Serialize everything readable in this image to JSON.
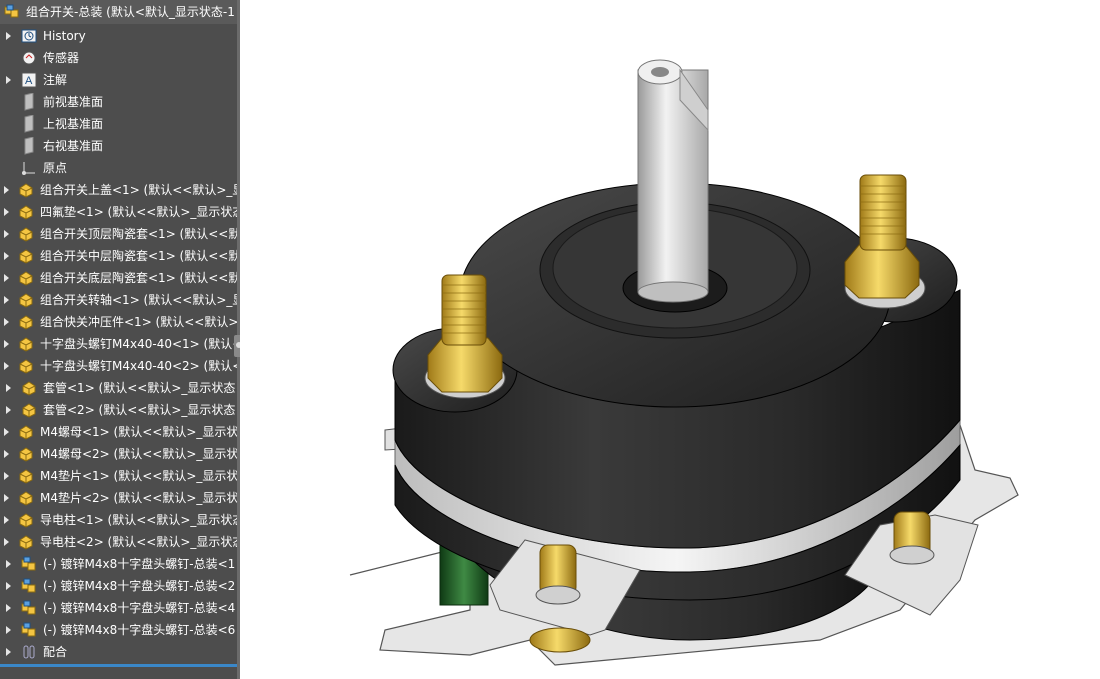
{
  "feature_tree": {
    "root": {
      "label": "组合开关-总装 (默认<默认_显示状态-1",
      "icon": "assembly-icon"
    },
    "items": [
      {
        "label": "History",
        "icon": "history-icon",
        "expandable": true
      },
      {
        "label": "传感器",
        "icon": "sensor-icon",
        "expandable": false
      },
      {
        "label": "注解",
        "icon": "annotation-icon",
        "expandable": true
      },
      {
        "label": "前视基准面",
        "icon": "plane-icon",
        "expandable": false
      },
      {
        "label": "上视基准面",
        "icon": "plane-icon",
        "expandable": false
      },
      {
        "label": "右视基准面",
        "icon": "plane-icon",
        "expandable": false
      },
      {
        "label": "原点",
        "icon": "origin-icon",
        "expandable": false
      },
      {
        "label": "组合开关上盖<1> (默认<<默认>_显",
        "icon": "part-icon",
        "expandable": true
      },
      {
        "label": "四氟垫<1> (默认<<默认>_显示状态",
        "icon": "part-icon",
        "expandable": true
      },
      {
        "label": "组合开关顶层陶瓷套<1> (默认<<默",
        "icon": "part-icon",
        "expandable": true
      },
      {
        "label": "组合开关中层陶瓷套<1> (默认<<默",
        "icon": "part-icon",
        "expandable": true
      },
      {
        "label": "组合开关底层陶瓷套<1> (默认<<默",
        "icon": "part-icon",
        "expandable": true
      },
      {
        "label": "组合开关转轴<1> (默认<<默认>_显",
        "icon": "part-icon",
        "expandable": true
      },
      {
        "label": "组合快关冲压件<1> (默认<<默认>_",
        "icon": "part-icon",
        "expandable": true
      },
      {
        "label": "十字盘头螺钉M4x40-40<1> (默认<",
        "icon": "part-icon",
        "expandable": true
      },
      {
        "label": "十字盘头螺钉M4x40-40<2> (默认<",
        "icon": "part-icon",
        "expandable": true
      },
      {
        "label": "套管<1> (默认<<默认>_显示状态",
        "icon": "part-icon",
        "expandable": true
      },
      {
        "label": "套管<2> (默认<<默认>_显示状态",
        "icon": "part-icon",
        "expandable": true
      },
      {
        "label": "M4螺母<1> (默认<<默认>_显示状",
        "icon": "part-icon",
        "expandable": true
      },
      {
        "label": "M4螺母<2> (默认<<默认>_显示状",
        "icon": "part-icon",
        "expandable": true
      },
      {
        "label": "M4垫片<1> (默认<<默认>_显示状",
        "icon": "part-icon",
        "expandable": true
      },
      {
        "label": "M4垫片<2> (默认<<默认>_显示状",
        "icon": "part-icon",
        "expandable": true
      },
      {
        "label": "导电柱<1> (默认<<默认>_显示状态",
        "icon": "part-icon",
        "expandable": true
      },
      {
        "label": "导电柱<2> (默认<<默认>_显示状态",
        "icon": "part-icon",
        "expandable": true
      },
      {
        "label": "(-) 镀锌M4x8十字盘头螺钉-总装<1",
        "icon": "subassembly-icon",
        "expandable": true
      },
      {
        "label": "(-) 镀锌M4x8十字盘头螺钉-总装<2",
        "icon": "subassembly-icon",
        "expandable": true
      },
      {
        "label": "(-) 镀锌M4x8十字盘头螺钉-总装<4",
        "icon": "subassembly-icon",
        "expandable": true
      },
      {
        "label": "(-) 镀锌M4x8十字盘头螺钉-总装<6",
        "icon": "subassembly-icon",
        "expandable": true
      },
      {
        "label": "配合",
        "icon": "mates-icon",
        "expandable": true
      }
    ]
  },
  "viewport": {
    "model_render": "rotary-combination-switch-assembly"
  }
}
